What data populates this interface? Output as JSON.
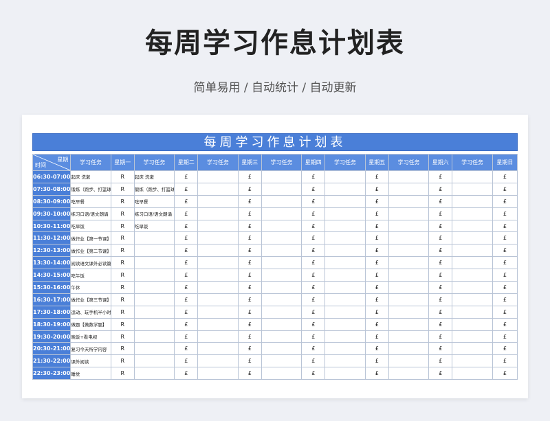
{
  "hero": {
    "title": "每周学习作息计划表",
    "subtitle": "简单易用 / 自动统计 / 自动更新"
  },
  "sheet": {
    "title": "每周学习作息计划表",
    "corner_top": "星期",
    "corner_bottom": "时间",
    "columns": [
      "学习任务",
      "星期一",
      "学习任务",
      "星期二",
      "学习任务",
      "星期三",
      "学习任务",
      "星期四",
      "学习任务",
      "星期五",
      "学习任务",
      "星期六",
      "学习任务",
      "星期日"
    ],
    "rows": [
      {
        "time": "06:30-07:00",
        "t1": "起床 洗漱",
        "m1": "R",
        "t2": "起床 洗漱",
        "m2": "£",
        "t3": "",
        "m3": "£",
        "t4": "",
        "m4": "£",
        "t5": "",
        "m5": "£",
        "t6": "",
        "m6": "£",
        "t7": "",
        "m7": "£"
      },
      {
        "time": "07:30-08:00",
        "t1": "锻炼（跑步、打篮球）",
        "m1": "R",
        "t2": "锻炼（跑步、打篮球）",
        "m2": "£",
        "t3": "",
        "m3": "£",
        "t4": "",
        "m4": "£",
        "t5": "",
        "m5": "£",
        "t6": "",
        "m6": "£",
        "t7": "",
        "m7": "£"
      },
      {
        "time": "08:30-09:00",
        "t1": "吃早餐",
        "m1": "R",
        "t2": "吃早餐",
        "m2": "£",
        "t3": "",
        "m3": "£",
        "t4": "",
        "m4": "£",
        "t5": "",
        "m5": "£",
        "t6": "",
        "m6": "£",
        "t7": "",
        "m7": "£"
      },
      {
        "time": "09:30-10:00",
        "t1": "练习口语/语文朗诵",
        "m1": "R",
        "t2": "练习口语/语文朗诵",
        "m2": "£",
        "t3": "",
        "m3": "£",
        "t4": "",
        "m4": "£",
        "t5": "",
        "m5": "£",
        "t6": "",
        "m6": "£",
        "t7": "",
        "m7": "£"
      },
      {
        "time": "10:30-11:00",
        "t1": "吃早饭",
        "m1": "R",
        "t2": "吃早饭",
        "m2": "£",
        "t3": "",
        "m3": "£",
        "t4": "",
        "m4": "£",
        "t5": "",
        "m5": "£",
        "t6": "",
        "m6": "£",
        "t7": "",
        "m7": "£"
      },
      {
        "time": "11:30-12:00",
        "t1": "做作业【第一节课】",
        "m1": "R",
        "t2": "",
        "m2": "£",
        "t3": "",
        "m3": "£",
        "t4": "",
        "m4": "£",
        "t5": "",
        "m5": "£",
        "t6": "",
        "m6": "£",
        "t7": "",
        "m7": "£"
      },
      {
        "time": "12:30-13:00",
        "t1": "做作业【第二节课】",
        "m1": "R",
        "t2": "",
        "m2": "£",
        "t3": "",
        "m3": "£",
        "t4": "",
        "m4": "£",
        "t5": "",
        "m5": "£",
        "t6": "",
        "m6": "£",
        "t7": "",
        "m7": "£"
      },
      {
        "time": "13:30-14:00",
        "t1": "阅读语文课外必读篇目",
        "m1": "R",
        "t2": "",
        "m2": "£",
        "t3": "",
        "m3": "£",
        "t4": "",
        "m4": "£",
        "t5": "",
        "m5": "£",
        "t6": "",
        "m6": "£",
        "t7": "",
        "m7": "£"
      },
      {
        "time": "14:30-15:00",
        "t1": "吃午饭",
        "m1": "R",
        "t2": "",
        "m2": "£",
        "t3": "",
        "m3": "£",
        "t4": "",
        "m4": "£",
        "t5": "",
        "m5": "£",
        "t6": "",
        "m6": "£",
        "t7": "",
        "m7": "£"
      },
      {
        "time": "15:30-16:00",
        "t1": "午休",
        "m1": "R",
        "t2": "",
        "m2": "£",
        "t3": "",
        "m3": "£",
        "t4": "",
        "m4": "£",
        "t5": "",
        "m5": "£",
        "t6": "",
        "m6": "£",
        "t7": "",
        "m7": "£"
      },
      {
        "time": "16:30-17:00",
        "t1": "做作业【第三节课】",
        "m1": "R",
        "t2": "",
        "m2": "£",
        "t3": "",
        "m3": "£",
        "t4": "",
        "m4": "£",
        "t5": "",
        "m5": "£",
        "t6": "",
        "m6": "£",
        "t7": "",
        "m7": "£"
      },
      {
        "time": "17:30-18:00",
        "t1": "运动、玩手机半小时",
        "m1": "R",
        "t2": "",
        "m2": "£",
        "t3": "",
        "m3": "£",
        "t4": "",
        "m4": "£",
        "t5": "",
        "m5": "£",
        "t6": "",
        "m6": "£",
        "t7": "",
        "m7": "£"
      },
      {
        "time": "18:30-19:00",
        "t1": "做题【做数学题】",
        "m1": "R",
        "t2": "",
        "m2": "£",
        "t3": "",
        "m3": "£",
        "t4": "",
        "m4": "£",
        "t5": "",
        "m5": "£",
        "t6": "",
        "m6": "£",
        "t7": "",
        "m7": "£"
      },
      {
        "time": "19:30-20:00",
        "t1": "晚饭+看电视",
        "m1": "R",
        "t2": "",
        "m2": "£",
        "t3": "",
        "m3": "£",
        "t4": "",
        "m4": "£",
        "t5": "",
        "m5": "£",
        "t6": "",
        "m6": "£",
        "t7": "",
        "m7": "£"
      },
      {
        "time": "20:30-21:00",
        "t1": "复习今天所学内容",
        "m1": "R",
        "t2": "",
        "m2": "£",
        "t3": "",
        "m3": "£",
        "t4": "",
        "m4": "£",
        "t5": "",
        "m5": "£",
        "t6": "",
        "m6": "£",
        "t7": "",
        "m7": "£"
      },
      {
        "time": "21:30-22:00",
        "t1": "课外阅读",
        "m1": "R",
        "t2": "",
        "m2": "£",
        "t3": "",
        "m3": "£",
        "t4": "",
        "m4": "£",
        "t5": "",
        "m5": "£",
        "t6": "",
        "m6": "£",
        "t7": "",
        "m7": "£"
      },
      {
        "time": "22:30-23:00",
        "t1": "睡觉",
        "m1": "R",
        "t2": "",
        "m2": "£",
        "t3": "",
        "m3": "£",
        "t4": "",
        "m4": "£",
        "t5": "",
        "m5": "£",
        "t6": "",
        "m6": "£",
        "t7": "",
        "m7": "£"
      }
    ]
  }
}
